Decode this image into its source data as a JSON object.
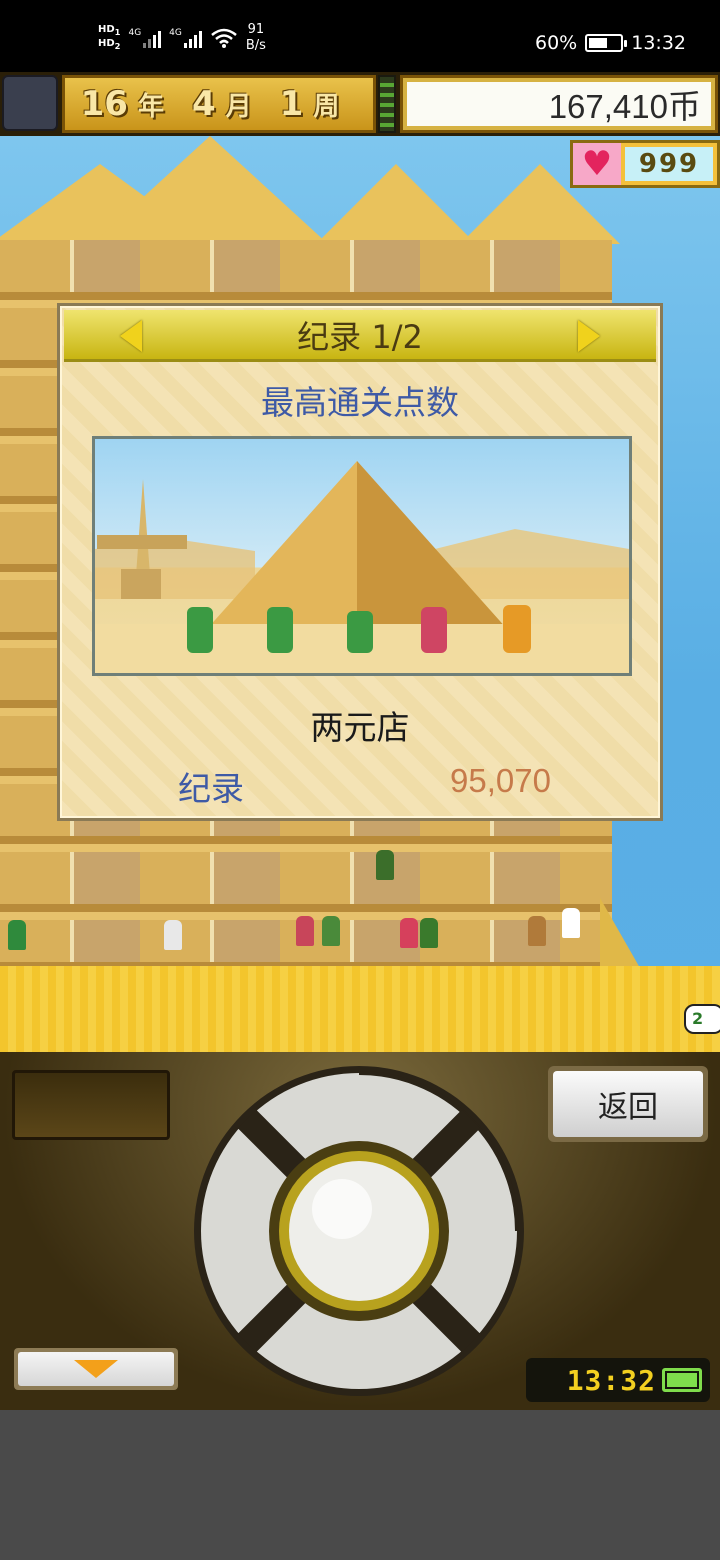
{
  "status_bar": {
    "hd1": "HD",
    "hd1_index": "1",
    "hd2": "HD",
    "hd2_index": "2",
    "net1": "4G",
    "net2": "4G",
    "speed_value": "91",
    "speed_unit": "B/s",
    "battery_percent": "60%",
    "time": "13:32"
  },
  "hud": {
    "year": "16",
    "year_unit": "年",
    "month": "4",
    "month_unit": "月",
    "week": "1",
    "week_unit": "周",
    "money": "167,410币",
    "popularity": "999"
  },
  "dialog": {
    "title": "纪录 1/2",
    "subtitle": "最高通关点数",
    "store_name": "两元店",
    "record_label": "纪录",
    "record_value": "95,070"
  },
  "world": {
    "speech_bubble": "2"
  },
  "controls": {
    "back_label": "返回",
    "clock": "13:32"
  },
  "colors": {
    "header_gold": "#c8b512",
    "record_blue": "#3e5aa6",
    "record_value": "#c67a4a",
    "sky": "#59aee4",
    "sand": "#f3c52c"
  },
  "icons": [
    "heart-icon",
    "arrow-left-icon",
    "arrow-right-icon",
    "down-arrow-icon",
    "battery-icon",
    "wifi-icon",
    "dpad"
  ]
}
